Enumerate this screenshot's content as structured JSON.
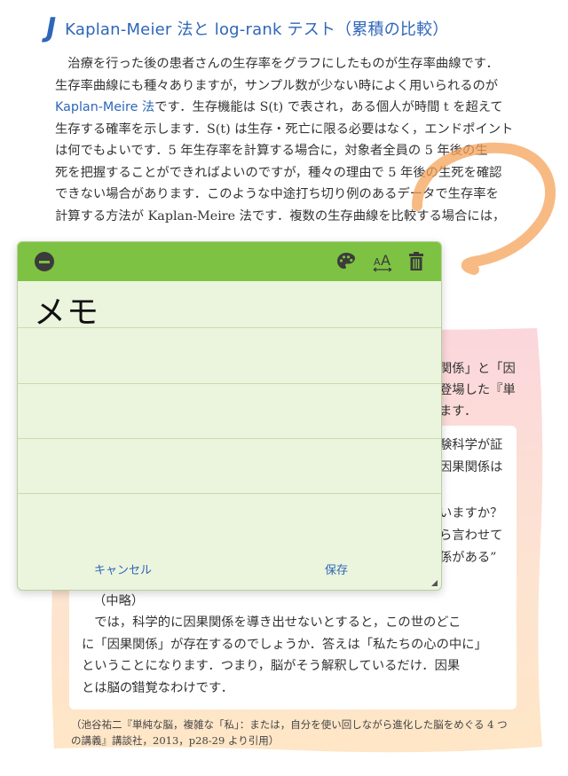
{
  "heading": {
    "icon": "J",
    "title": "Kaplan-Meier 法と log-rank テスト（累積の比較）"
  },
  "body": {
    "line1": "治療を行った後の患者さんの生存率をグラフにしたものが生存率曲線です．",
    "line2": "生存率曲線にも種々ありますが，サンプル数が少ない時によく用いられるのが",
    "line3_link": "Kaplan-Meire 法",
    "line3_rest": "です．生存機能は S(t) で表され，ある個人が時間 t を超えて",
    "line4": "生存する確率を示します．S(t) は生存・死亡に限る必要はなく，エンドポイント",
    "line5": "は何でもよいです．5 年生存率を計算する場合に，対象者全員の 5 年後の生",
    "line6": "死を把握することができればよいのですが，種々の理由で 5 年後の生死を確認",
    "line7": "できない場合があります．このような中途打ち切り例のあるデータで生存率を",
    "line8": "計算する方法が Kaplan-Meire 法です．複数の生存曲線を比較する場合には，"
  },
  "quote": {
    "r1": "関係」と「因",
    "r2": "登場した『単",
    "r3": "ます．",
    "r4": "験科学が証",
    "r5": "因果関係は",
    "r6": "いますか？",
    "r7": "ら言わせて",
    "r8": "係がある”",
    "omitted": "（中略）",
    "p1": "では，科学的に因果関係を導き出せないとすると，この世のどこ",
    "p2": "に「因果関係」が存在するのでしょうか．答えは「私たちの心の中に」",
    "p3": "ということになります．つまり，脳がそう解釈しているだけ．因果",
    "p4": "とは脳の錯覚なわけです．",
    "dots": "・・・・",
    "citation1": "（池谷祐二『単純な脳，複雑な「私」：または，自分を使い回しながら進化した脳をめぐる 4 つ",
    "citation2": "の講義』講談社，2013，p28-29 より引用）"
  },
  "memo": {
    "text": "メモ",
    "cancel_label": "キャンセル",
    "save_label": "保存",
    "font_size_icon_label": "AA",
    "colors": {
      "bar": "#7dc242",
      "paper": "#ebf4dc",
      "button": "#2e66b8"
    }
  }
}
